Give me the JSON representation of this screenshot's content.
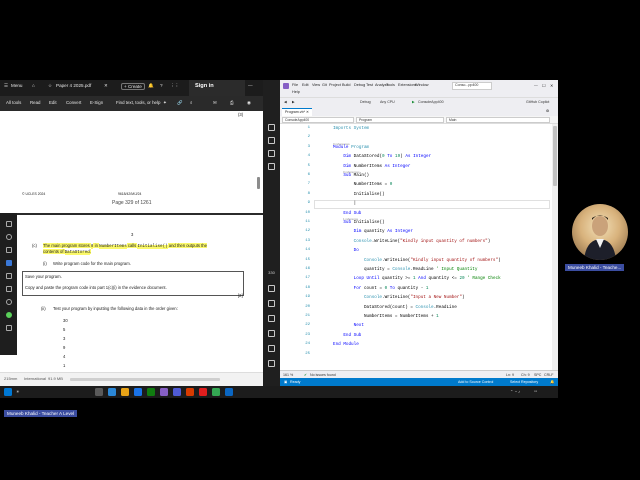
{
  "pdf": {
    "tabs": {
      "menu": "Menu",
      "doc_title": "Paper 4 2025.pdf",
      "create": "Create",
      "sign_in": "Sign in"
    },
    "menu": {
      "all_tools": "All tools",
      "read": "Read",
      "edit": "Edit",
      "convert": "Convert",
      "esign": "E-Sign",
      "find_placeholder": "Find text, tools, or help"
    },
    "page_top": {
      "page_num_right": "(3)",
      "footer_left": "© UCLES 2024",
      "footer_mid": "9618/42/M/J/24",
      "page_of": "Page 329 of 1261"
    },
    "page_bottom": {
      "page_center": "3",
      "q_label": "(c)",
      "q_line1_pre": "The main program stores ",
      "q_line1_code1": "0",
      "q_line1_mid": " in ",
      "q_line1_code2": "NumberItems",
      "q_line1_mid2": " calls ",
      "q_line1_code3": "Initialise()",
      "q_line1_post": " and then outputs the",
      "q_line2_pre": "contents of ",
      "q_line2_code": "DataStored",
      "q_line2_post": ".",
      "sub_i_label": "(i)",
      "sub_i_text": "Write program code for the main program.",
      "box_line1": "Save your program.",
      "box_line2": "Copy and paste the program code into part 1(c)(i) in the evidence document.",
      "marks_i": "[2]",
      "sub_ii_label": "(ii)",
      "sub_ii_text": "Test your program by inputting the following data in the order given:",
      "test_values": [
        "30",
        "5",
        "3",
        "9",
        "4",
        "1"
      ]
    },
    "status": {
      "left": "215mm",
      "mid": "International",
      "size": "91.9 MB"
    }
  },
  "vs": {
    "title": {
      "menus": [
        "File",
        "Edit",
        "View",
        "Git",
        "Project",
        "Build",
        "Debug",
        "Test",
        "Analyze",
        "Tools",
        "Extensions",
        "Window"
      ],
      "help": "Help",
      "search": "Conso...pp400"
    },
    "toolbar": {
      "debug": "Debug",
      "cpu": "Any CPU",
      "run": "ConsoleApp400",
      "copilot": "GitHub Copilot"
    },
    "tab": "Program.vb*",
    "nav": {
      "left": "ConsoleApp400",
      "mid": "Program",
      "right": "Main"
    },
    "code_lines": [
      {
        "n": "1",
        "parts": [
          {
            "c": "ty",
            "t": "Imports System"
          }
        ]
      },
      {
        "n": "2",
        "parts": []
      },
      {
        "n": "3",
        "ref": "0 references",
        "parts": [
          {
            "c": "kw",
            "t": "Module"
          },
          {
            "c": "",
            "t": " "
          },
          {
            "c": "ty",
            "t": "Program"
          }
        ]
      },
      {
        "n": "4",
        "parts": [
          {
            "c": "",
            "t": "    "
          },
          {
            "c": "kw",
            "t": "Dim"
          },
          {
            "c": "",
            "t": " DataStored("
          },
          {
            "c": "nm",
            "t": "0"
          },
          {
            "c": "",
            "t": " "
          },
          {
            "c": "kw",
            "t": "To"
          },
          {
            "c": "",
            "t": " "
          },
          {
            "c": "nm",
            "t": "19"
          },
          {
            "c": "",
            "t": ") "
          },
          {
            "c": "kw",
            "t": "As Integer"
          }
        ]
      },
      {
        "n": "5",
        "parts": [
          {
            "c": "",
            "t": "    "
          },
          {
            "c": "kw",
            "t": "Dim"
          },
          {
            "c": "",
            "t": " NumberItems "
          },
          {
            "c": "kw",
            "t": "As Integer"
          }
        ]
      },
      {
        "n": "6",
        "ref": "0 references",
        "parts": [
          {
            "c": "",
            "t": "    "
          },
          {
            "c": "kw",
            "t": "Sub"
          },
          {
            "c": "",
            "t": " Main()"
          }
        ]
      },
      {
        "n": "7",
        "parts": [
          {
            "c": "",
            "t": "        NumberItems = "
          },
          {
            "c": "nm",
            "t": "0"
          }
        ]
      },
      {
        "n": "8",
        "parts": [
          {
            "c": "",
            "t": "        Initialise()"
          }
        ]
      },
      {
        "n": "9",
        "parts": [
          {
            "c": "",
            "t": "        |"
          }
        ]
      },
      {
        "n": "10",
        "parts": [
          {
            "c": "",
            "t": "    "
          },
          {
            "c": "kw",
            "t": "End Sub"
          }
        ]
      },
      {
        "n": "11",
        "ref": "1 reference",
        "parts": [
          {
            "c": "",
            "t": "    "
          },
          {
            "c": "kw",
            "t": "Sub"
          },
          {
            "c": "",
            "t": " Initialise()"
          }
        ]
      },
      {
        "n": "12",
        "parts": [
          {
            "c": "",
            "t": "        "
          },
          {
            "c": "kw",
            "t": "Dim"
          },
          {
            "c": "",
            "t": " quantity "
          },
          {
            "c": "kw",
            "t": "As Integer"
          }
        ]
      },
      {
        "n": "13",
        "parts": [
          {
            "c": "",
            "t": "        "
          },
          {
            "c": "ty",
            "t": "Console"
          },
          {
            "c": "",
            "t": ".WriteLine("
          },
          {
            "c": "st",
            "t": "\"Kindly input quantity of numbers\""
          },
          {
            "c": "",
            "t": ")"
          }
        ]
      },
      {
        "n": "14",
        "parts": [
          {
            "c": "",
            "t": "        "
          },
          {
            "c": "kw",
            "t": "Do"
          }
        ]
      },
      {
        "n": "15",
        "parts": [
          {
            "c": "",
            "t": "            "
          },
          {
            "c": "ty",
            "t": "Console"
          },
          {
            "c": "",
            "t": ".WriteLine("
          },
          {
            "c": "st",
            "t": "\"Kindly input quantity of numbers\""
          },
          {
            "c": "",
            "t": ")"
          }
        ]
      },
      {
        "n": "16",
        "parts": [
          {
            "c": "",
            "t": "            quantity = "
          },
          {
            "c": "ty",
            "t": "Console"
          },
          {
            "c": "",
            "t": ".ReadLine "
          },
          {
            "c": "cm",
            "t": "' Input Quantity"
          }
        ]
      },
      {
        "n": "17",
        "parts": [
          {
            "c": "",
            "t": "        "
          },
          {
            "c": "kw",
            "t": "Loop Until"
          },
          {
            "c": "",
            "t": " quantity >= "
          },
          {
            "c": "nm",
            "t": "1"
          },
          {
            "c": "",
            "t": " "
          },
          {
            "c": "kw",
            "t": "And"
          },
          {
            "c": "",
            "t": " quantity <= "
          },
          {
            "c": "nm",
            "t": "20"
          },
          {
            "c": "",
            "t": " "
          },
          {
            "c": "cm",
            "t": "' Range Check"
          }
        ]
      },
      {
        "n": "18",
        "parts": [
          {
            "c": "",
            "t": "        "
          },
          {
            "c": "kw",
            "t": "For"
          },
          {
            "c": "",
            "t": " count = "
          },
          {
            "c": "nm",
            "t": "0"
          },
          {
            "c": "",
            "t": " "
          },
          {
            "c": "kw",
            "t": "To"
          },
          {
            "c": "",
            "t": " quantity - "
          },
          {
            "c": "nm",
            "t": "1"
          }
        ]
      },
      {
        "n": "19",
        "parts": [
          {
            "c": "",
            "t": "            "
          },
          {
            "c": "ty",
            "t": "Console"
          },
          {
            "c": "",
            "t": ".WriteLine("
          },
          {
            "c": "st",
            "t": "\"Input a New Number\""
          },
          {
            "c": "",
            "t": ")"
          }
        ]
      },
      {
        "n": "20",
        "parts": [
          {
            "c": "",
            "t": "            DataStored(count) = "
          },
          {
            "c": "ty",
            "t": "Console"
          },
          {
            "c": "",
            "t": ".ReadLine"
          }
        ]
      },
      {
        "n": "21",
        "parts": [
          {
            "c": "",
            "t": "            NumberItems = NumberItems + "
          },
          {
            "c": "nm",
            "t": "1"
          }
        ]
      },
      {
        "n": "22",
        "parts": [
          {
            "c": "",
            "t": "        "
          },
          {
            "c": "kw",
            "t": "Next"
          }
        ]
      },
      {
        "n": "23",
        "parts": [
          {
            "c": "",
            "t": "    "
          },
          {
            "c": "kw",
            "t": "End Sub"
          }
        ]
      },
      {
        "n": "24",
        "parts": [
          {
            "c": "kw",
            "t": "End Module"
          }
        ]
      },
      {
        "n": "25",
        "parts": []
      }
    ],
    "bottom": {
      "zoom": "161 %",
      "issues": "No issues found",
      "ln": "Ln: 9",
      "ch": "Ch: 9",
      "spc": "SPC",
      "crlf": "CRLF"
    },
    "status": {
      "ready": "Ready",
      "add_sc": "Add to Source Control",
      "repo": "Select Repository"
    }
  },
  "participant": {
    "name": "Muneeb Khalid - Teache..."
  },
  "presenter": {
    "name": "Muneeb Khalid - Teacher A Level"
  }
}
